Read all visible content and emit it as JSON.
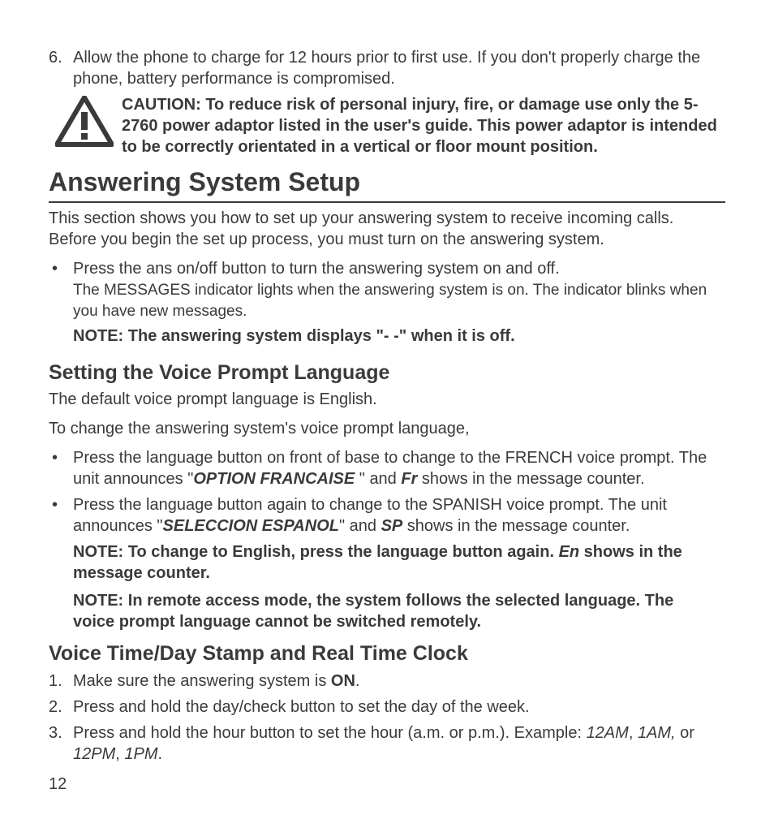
{
  "item6": {
    "num": "6.",
    "text": "Allow the phone to charge for 12 hours prior to first use. If you don't properly charge the phone, battery performance is compromised."
  },
  "caution": "CAUTION: To reduce risk of personal injury, fire, or damage use only the 5-2760 power adaptor listed in the user's guide. This power adaptor is intended to be correctly orientated in a vertical or floor mount position.",
  "h1": "Answering System Setup",
  "intro": "This section shows you how to set up your answering system to receive incoming calls. Before you begin the set up process, you must turn on the answering system.",
  "ans_bullet": {
    "line1": "Press the ans on/off button to turn the answering system on and off.",
    "line2": "The MESSAGES indicator lights when the answering system is on. The indicator blinks when you have new messages."
  },
  "ans_note": "NOTE: The answering system displays \"- -\" when it is off.",
  "h2a": "Setting the Voice Prompt Language",
  "lang_default": "The default voice prompt language is English.",
  "lang_change_intro": "To change the answering system's voice prompt language,",
  "lang_b1": {
    "pre": "Press the language button on front of base to change to the FRENCH voice prompt. The unit announces \"",
    "em": "OPTION FRANCAISE ",
    "mid": "\" and  ",
    "em2": "Fr",
    "post": "  shows in the message counter."
  },
  "lang_b2": {
    "pre": "Press the language button again to change to the SPANISH voice prompt.  The unit announces  \"",
    "em": "SELECCION ESPANOL",
    "mid": "\" and ",
    "em2": "SP",
    "post": " shows in the message counter."
  },
  "lang_note1": {
    "pre": "NOTE: To change to English, press the language button again. ",
    "em": "En",
    "post": " shows in the message counter."
  },
  "lang_note2": "NOTE: In remote access mode, the system follows the selected language. The voice prompt language cannot be switched remotely.",
  "h2b": "Voice Time/Day Stamp and Real Time Clock",
  "clock": {
    "n1": "1.",
    "t1a": "Make sure the answering system is ",
    "t1b": "ON",
    "t1c": ".",
    "n2": "2.",
    "t2": "Press and hold the day/check button to set the day of the week.",
    "n3": "3.",
    "t3a": "Press and hold the hour button to set the hour (a.m. or p.m.). Example: ",
    "t3b": "12AM",
    "t3c": ", ",
    "t3d": "1AM,",
    "t3e": " or ",
    "t3f": "12PM",
    "t3g": ", ",
    "t3h": "1PM",
    "t3i": "."
  },
  "page": "12"
}
